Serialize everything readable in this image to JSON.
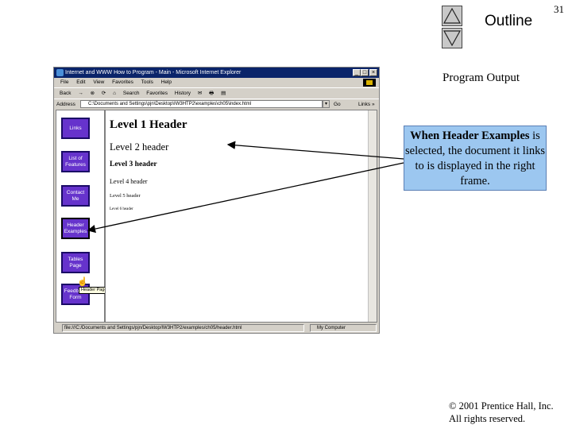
{
  "slide": {
    "page_number": "31",
    "outline_label": "Outline",
    "section_title": "Program Output",
    "callout": {
      "bold_lead": "When Header Examples",
      "rest": "is selected, the document it links to is displayed in the right frame."
    },
    "copyright_line1": "© 2001 Prentice Hall, Inc.",
    "copyright_line2": "All rights reserved."
  },
  "browser": {
    "title": "Internet and WWW How to Program - Main - Microsoft Internet Explorer",
    "window_controls": [
      "_",
      "□",
      "×"
    ],
    "menu": [
      "File",
      "Edit",
      "View",
      "Favorites",
      "Tools",
      "Help"
    ],
    "toolbar": [
      "Back",
      "→",
      "⊗",
      "⟳",
      "⌂",
      "Search",
      "Favorites",
      "History",
      "✉",
      "🖶",
      "▤"
    ],
    "address_label": "Address",
    "address_value": "C:\\Documents and Settings\\pjn\\Desktop\\IW3HTP2\\examples\\ch05\\index.html",
    "go_label": "Go",
    "links_label": "Links »",
    "status_text": "file:///C:/Documents and Settings/pjn/Desktop/IW3HTP2/examples/ch05/header.html",
    "zone_text": "My Computer",
    "colors": {
      "titlebar": "#0a246a",
      "nav_button": "#6633cc",
      "callout": "#9cc7f0"
    }
  },
  "left_frame": {
    "nav_buttons": [
      {
        "label": "Links"
      },
      {
        "label": "List of Features"
      },
      {
        "label": "Contact Me"
      },
      {
        "label": "Header Examples"
      },
      {
        "label": "Tables Page"
      },
      {
        "label": "Feedback Form"
      }
    ],
    "tooltip": "Header Page"
  },
  "right_frame": {
    "headers": [
      "Level 1 Header",
      "Level 2 header",
      "Level 3 header",
      "Level 4 header",
      "Level 5 header",
      "Level 6 header"
    ]
  }
}
